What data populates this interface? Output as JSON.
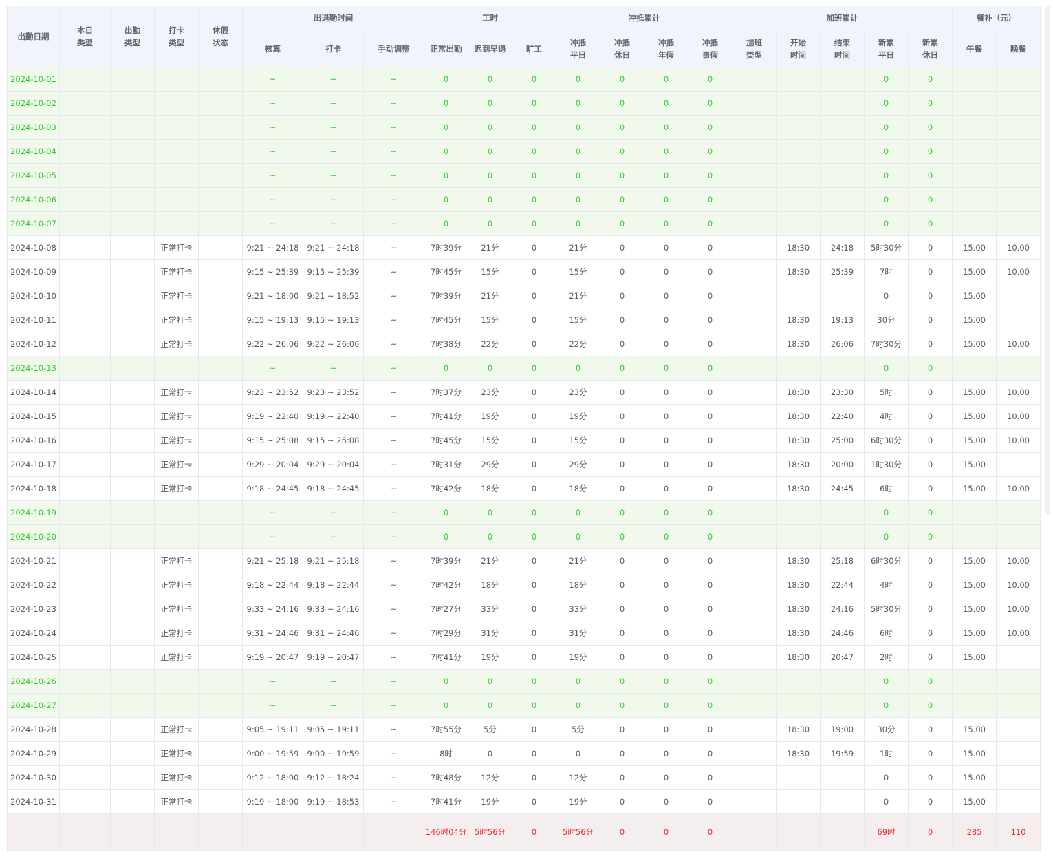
{
  "header": {
    "top": {
      "date": "出勤日期",
      "day_type": [
        "本日",
        "类型"
      ],
      "attend_type": [
        "出勤",
        "类型"
      ],
      "punch_type": [
        "打卡",
        "类型"
      ],
      "leave_status": [
        "休假",
        "状态"
      ],
      "attend_time": "出退勤时间",
      "work_hours": "工时",
      "offset": "冲抵累计",
      "overtime": "加班累计",
      "meal": "餐补（元）"
    },
    "sub": {
      "calc": "核算",
      "punch": "打卡",
      "manual": "手动调整",
      "normal": "正常出勤",
      "late": "迟到早退",
      "absent": "旷工",
      "off_weekday": [
        "冲抵",
        "平日"
      ],
      "off_restday": [
        "冲抵",
        "休日"
      ],
      "off_annual": [
        "冲抵",
        "年假"
      ],
      "off_personal": [
        "冲抵",
        "事假"
      ],
      "ot_type": [
        "加班",
        "类型"
      ],
      "ot_start": [
        "开始",
        "时间"
      ],
      "ot_end": [
        "结束",
        "时间"
      ],
      "new_weekday": [
        "新累",
        "平日"
      ],
      "new_restday": [
        "新累",
        "休日"
      ],
      "lunch": "午餐",
      "dinner": "晚餐"
    }
  },
  "rows": [
    {
      "rest": true,
      "cells": [
        "2024-10-01",
        "",
        "",
        "",
        "",
        "~",
        "~",
        "~",
        "0",
        "0",
        "0",
        "0",
        "0",
        "0",
        "0",
        "",
        "",
        "",
        "0",
        "0",
        "",
        ""
      ]
    },
    {
      "rest": true,
      "cells": [
        "2024-10-02",
        "",
        "",
        "",
        "",
        "~",
        "~",
        "~",
        "0",
        "0",
        "0",
        "0",
        "0",
        "0",
        "0",
        "",
        "",
        "",
        "0",
        "0",
        "",
        ""
      ]
    },
    {
      "rest": true,
      "cells": [
        "2024-10-03",
        "",
        "",
        "",
        "",
        "~",
        "~",
        "~",
        "0",
        "0",
        "0",
        "0",
        "0",
        "0",
        "0",
        "",
        "",
        "",
        "0",
        "0",
        "",
        ""
      ]
    },
    {
      "rest": true,
      "cells": [
        "2024-10-04",
        "",
        "",
        "",
        "",
        "~",
        "~",
        "~",
        "0",
        "0",
        "0",
        "0",
        "0",
        "0",
        "0",
        "",
        "",
        "",
        "0",
        "0",
        "",
        ""
      ]
    },
    {
      "rest": true,
      "cells": [
        "2024-10-05",
        "",
        "",
        "",
        "",
        "~",
        "~",
        "~",
        "0",
        "0",
        "0",
        "0",
        "0",
        "0",
        "0",
        "",
        "",
        "",
        "0",
        "0",
        "",
        ""
      ]
    },
    {
      "rest": true,
      "cells": [
        "2024-10-06",
        "",
        "",
        "",
        "",
        "~",
        "~",
        "~",
        "0",
        "0",
        "0",
        "0",
        "0",
        "0",
        "0",
        "",
        "",
        "",
        "0",
        "0",
        "",
        ""
      ]
    },
    {
      "rest": true,
      "cells": [
        "2024-10-07",
        "",
        "",
        "",
        "",
        "~",
        "~",
        "~",
        "0",
        "0",
        "0",
        "0",
        "0",
        "0",
        "0",
        "",
        "",
        "",
        "0",
        "0",
        "",
        ""
      ]
    },
    {
      "rest": false,
      "cells": [
        "2024-10-08",
        "",
        "",
        "正常打卡",
        "",
        "9:21 ~ 24:18",
        "9:21 ~ 24:18",
        "~",
        "7时39分",
        "21分",
        "0",
        "21分",
        "0",
        "0",
        "0",
        "",
        "18:30",
        "24:18",
        "5时30分",
        "0",
        "15.00",
        "10.00"
      ]
    },
    {
      "rest": false,
      "cells": [
        "2024-10-09",
        "",
        "",
        "正常打卡",
        "",
        "9:15 ~ 25:39",
        "9:15 ~ 25:39",
        "~",
        "7时45分",
        "15分",
        "0",
        "15分",
        "0",
        "0",
        "0",
        "",
        "18:30",
        "25:39",
        "7时",
        "0",
        "15.00",
        "10.00"
      ]
    },
    {
      "rest": false,
      "cells": [
        "2024-10-10",
        "",
        "",
        "正常打卡",
        "",
        "9:21 ~ 18:00",
        "9:21 ~ 18:52",
        "~",
        "7时39分",
        "21分",
        "0",
        "21分",
        "0",
        "0",
        "0",
        "",
        "",
        "",
        "0",
        "0",
        "15.00",
        ""
      ]
    },
    {
      "rest": false,
      "cells": [
        "2024-10-11",
        "",
        "",
        "正常打卡",
        "",
        "9:15 ~ 19:13",
        "9:15 ~ 19:13",
        "~",
        "7时45分",
        "15分",
        "0",
        "15分",
        "0",
        "0",
        "0",
        "",
        "18:30",
        "19:13",
        "30分",
        "0",
        "15.00",
        ""
      ]
    },
    {
      "rest": false,
      "cells": [
        "2024-10-12",
        "",
        "",
        "正常打卡",
        "",
        "9:22 ~ 26:06",
        "9:22 ~ 26:06",
        "~",
        "7时38分",
        "22分",
        "0",
        "22分",
        "0",
        "0",
        "0",
        "",
        "18:30",
        "26:06",
        "7时30分",
        "0",
        "15.00",
        "10.00"
      ]
    },
    {
      "rest": true,
      "cells": [
        "2024-10-13",
        "",
        "",
        "",
        "",
        "~",
        "~",
        "~",
        "0",
        "0",
        "0",
        "0",
        "0",
        "0",
        "0",
        "",
        "",
        "",
        "0",
        "0",
        "",
        ""
      ]
    },
    {
      "rest": false,
      "cells": [
        "2024-10-14",
        "",
        "",
        "正常打卡",
        "",
        "9:23 ~ 23:52",
        "9:23 ~ 23:52",
        "~",
        "7时37分",
        "23分",
        "0",
        "23分",
        "0",
        "0",
        "0",
        "",
        "18:30",
        "23:30",
        "5时",
        "0",
        "15.00",
        "10.00"
      ]
    },
    {
      "rest": false,
      "cells": [
        "2024-10-15",
        "",
        "",
        "正常打卡",
        "",
        "9:19 ~ 22:40",
        "9:19 ~ 22:40",
        "~",
        "7时41分",
        "19分",
        "0",
        "19分",
        "0",
        "0",
        "0",
        "",
        "18:30",
        "22:40",
        "4时",
        "0",
        "15.00",
        "10.00"
      ]
    },
    {
      "rest": false,
      "cells": [
        "2024-10-16",
        "",
        "",
        "正常打卡",
        "",
        "9:15 ~ 25:08",
        "9:15 ~ 25:08",
        "~",
        "7时45分",
        "15分",
        "0",
        "15分",
        "0",
        "0",
        "0",
        "",
        "18:30",
        "25:00",
        "6时30分",
        "0",
        "15.00",
        "10.00"
      ]
    },
    {
      "rest": false,
      "cells": [
        "2024-10-17",
        "",
        "",
        "正常打卡",
        "",
        "9:29 ~ 20:04",
        "9:29 ~ 20:04",
        "~",
        "7时31分",
        "29分",
        "0",
        "29分",
        "0",
        "0",
        "0",
        "",
        "18:30",
        "20:00",
        "1时30分",
        "0",
        "15.00",
        ""
      ]
    },
    {
      "rest": false,
      "cells": [
        "2024-10-18",
        "",
        "",
        "正常打卡",
        "",
        "9:18 ~ 24:45",
        "9:18 ~ 24:45",
        "~",
        "7时42分",
        "18分",
        "0",
        "18分",
        "0",
        "0",
        "0",
        "",
        "18:30",
        "24:45",
        "6时",
        "0",
        "15.00",
        "10.00"
      ]
    },
    {
      "rest": true,
      "cells": [
        "2024-10-19",
        "",
        "",
        "",
        "",
        "~",
        "~",
        "~",
        "0",
        "0",
        "0",
        "0",
        "0",
        "0",
        "0",
        "",
        "",
        "",
        "0",
        "0",
        "",
        ""
      ]
    },
    {
      "rest": true,
      "cells": [
        "2024-10-20",
        "",
        "",
        "",
        "",
        "~",
        "~",
        "~",
        "0",
        "0",
        "0",
        "0",
        "0",
        "0",
        "0",
        "",
        "",
        "",
        "0",
        "0",
        "",
        ""
      ]
    },
    {
      "rest": false,
      "cells": [
        "2024-10-21",
        "",
        "",
        "正常打卡",
        "",
        "9:21 ~ 25:18",
        "9:21 ~ 25:18",
        "~",
        "7时39分",
        "21分",
        "0",
        "21分",
        "0",
        "0",
        "0",
        "",
        "18:30",
        "25:18",
        "6时30分",
        "0",
        "15.00",
        "10.00"
      ]
    },
    {
      "rest": false,
      "cells": [
        "2024-10-22",
        "",
        "",
        "正常打卡",
        "",
        "9:18 ~ 22:44",
        "9:18 ~ 22:44",
        "~",
        "7时42分",
        "18分",
        "0",
        "18分",
        "0",
        "0",
        "0",
        "",
        "18:30",
        "22:44",
        "4时",
        "0",
        "15.00",
        "10.00"
      ]
    },
    {
      "rest": false,
      "cells": [
        "2024-10-23",
        "",
        "",
        "正常打卡",
        "",
        "9:33 ~ 24:16",
        "9:33 ~ 24:16",
        "~",
        "7时27分",
        "33分",
        "0",
        "33分",
        "0",
        "0",
        "0",
        "",
        "18:30",
        "24:16",
        "5时30分",
        "0",
        "15.00",
        "10.00"
      ]
    },
    {
      "rest": false,
      "cells": [
        "2024-10-24",
        "",
        "",
        "正常打卡",
        "",
        "9:31 ~ 24:46",
        "9:31 ~ 24:46",
        "~",
        "7时29分",
        "31分",
        "0",
        "31分",
        "0",
        "0",
        "0",
        "",
        "18:30",
        "24:46",
        "6时",
        "0",
        "15.00",
        "10.00"
      ]
    },
    {
      "rest": false,
      "cells": [
        "2024-10-25",
        "",
        "",
        "正常打卡",
        "",
        "9:19 ~ 20:47",
        "9:19 ~ 20:47",
        "~",
        "7时41分",
        "19分",
        "0",
        "19分",
        "0",
        "0",
        "0",
        "",
        "18:30",
        "20:47",
        "2时",
        "0",
        "15.00",
        ""
      ]
    },
    {
      "rest": true,
      "cells": [
        "2024-10-26",
        "",
        "",
        "",
        "",
        "~",
        "~",
        "~",
        "0",
        "0",
        "0",
        "0",
        "0",
        "0",
        "0",
        "",
        "",
        "",
        "0",
        "0",
        "",
        ""
      ]
    },
    {
      "rest": true,
      "cells": [
        "2024-10-27",
        "",
        "",
        "",
        "",
        "~",
        "~",
        "~",
        "0",
        "0",
        "0",
        "0",
        "0",
        "0",
        "0",
        "",
        "",
        "",
        "0",
        "0",
        "",
        ""
      ]
    },
    {
      "rest": false,
      "cells": [
        "2024-10-28",
        "",
        "",
        "正常打卡",
        "",
        "9:05 ~ 19:11",
        "9:05 ~ 19:11",
        "~",
        "7时55分",
        "5分",
        "0",
        "5分",
        "0",
        "0",
        "0",
        "",
        "18:30",
        "19:00",
        "30分",
        "0",
        "15.00",
        ""
      ]
    },
    {
      "rest": false,
      "cells": [
        "2024-10-29",
        "",
        "",
        "正常打卡",
        "",
        "9:00 ~ 19:59",
        "9:00 ~ 19:59",
        "~",
        "8时",
        "0",
        "0",
        "0",
        "0",
        "0",
        "0",
        "",
        "18:30",
        "19:59",
        "1时",
        "0",
        "15.00",
        ""
      ]
    },
    {
      "rest": false,
      "cells": [
        "2024-10-30",
        "",
        "",
        "正常打卡",
        "",
        "9:12 ~ 18:00",
        "9:12 ~ 18:24",
        "~",
        "7时48分",
        "12分",
        "0",
        "12分",
        "0",
        "0",
        "0",
        "",
        "",
        "",
        "0",
        "0",
        "15.00",
        ""
      ]
    },
    {
      "rest": false,
      "cells": [
        "2024-10-31",
        "",
        "",
        "正常打卡",
        "",
        "9:19 ~ 18:00",
        "9:19 ~ 18:53",
        "~",
        "7时41分",
        "19分",
        "0",
        "19分",
        "0",
        "0",
        "0",
        "",
        "",
        "",
        "0",
        "0",
        "15.00",
        ""
      ]
    }
  ],
  "totals": [
    "",
    "",
    "",
    "",
    "",
    "",
    "",
    "",
    "146时04分",
    "5时56分",
    "0",
    "5时56分",
    "0",
    "0",
    "0",
    "",
    "",
    "",
    "69时",
    "0",
    "285",
    "110"
  ],
  "colors": {
    "rest_text": "#2ecc2e",
    "total_text": "#f02c2c",
    "header_bg": "#f1f5fb",
    "rest_bg": "#f1f9ec",
    "total_bg": "#f5eeee"
  }
}
